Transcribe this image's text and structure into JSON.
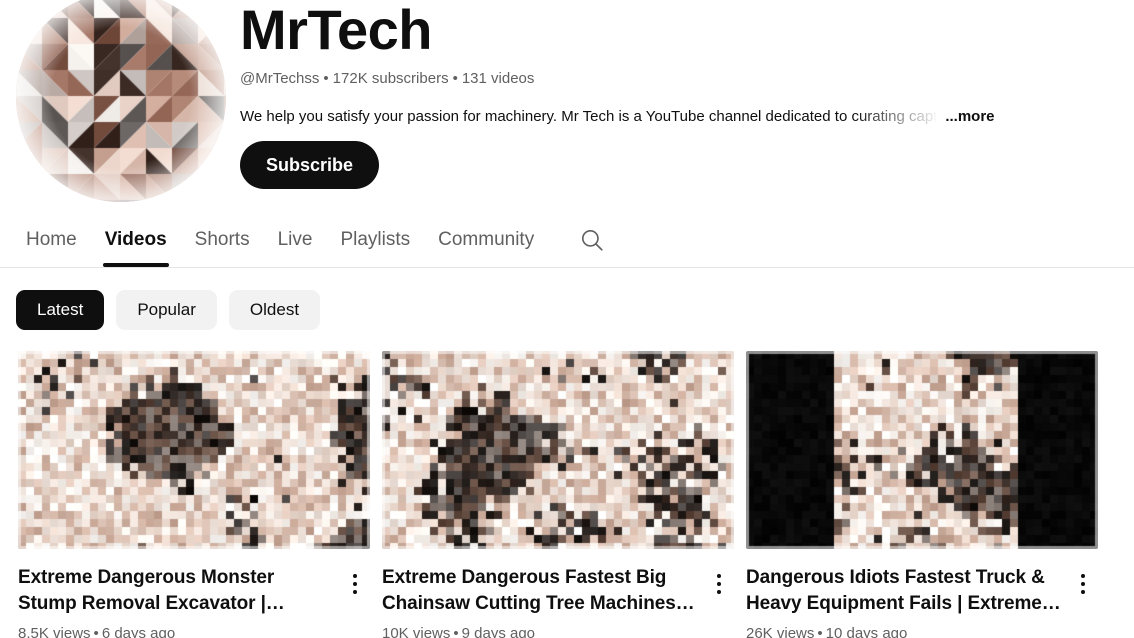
{
  "channel": {
    "name": "MrTech",
    "handle": "@MrTechss",
    "subscribers": "172K subscribers",
    "videos_count": "131 videos",
    "separator": "•",
    "description": "We help you satisfy your passion for machinery. Mr Tech is a YouTube channel dedicated to curating capt",
    "more_label": "...more",
    "subscribe_label": "Subscribe",
    "avatar_alt": "channel-avatar"
  },
  "tabs": [
    {
      "label": "Home",
      "active": false
    },
    {
      "label": "Videos",
      "active": true
    },
    {
      "label": "Shorts",
      "active": false
    },
    {
      "label": "Live",
      "active": false
    },
    {
      "label": "Playlists",
      "active": false
    },
    {
      "label": "Community",
      "active": false
    }
  ],
  "search_icon": "search-icon",
  "chips": [
    {
      "label": "Latest",
      "selected": true
    },
    {
      "label": "Popular",
      "selected": false
    },
    {
      "label": "Oldest",
      "selected": false
    }
  ],
  "videos": [
    {
      "title": "Extreme Dangerous Monster Stump Removal Excavator | Fastest Stump...",
      "views": "8.5K views",
      "age": "6 days ago",
      "separator": "•",
      "thumb_style": "pixelated-light",
      "menu_icon": "more-vertical-icon"
    },
    {
      "title": "Extreme Dangerous Fastest Big Chainsaw Cutting Tree Machines |...",
      "views": "10K views",
      "age": "9 days ago",
      "separator": "•",
      "thumb_style": "pixelated-light",
      "menu_icon": "more-vertical-icon"
    },
    {
      "title": "Dangerous Idiots Fastest Truck & Heavy Equipment Fails | Extreme Truc...",
      "views": "26K views",
      "age": "10 days ago",
      "separator": "•",
      "thumb_style": "pixelated-letterbox",
      "menu_icon": "more-vertical-icon"
    }
  ],
  "colors": {
    "text_primary": "#0f0f0f",
    "text_secondary": "#606060",
    "chip_bg": "#f2f2f2",
    "chip_selected_bg": "#0f0f0f",
    "divider": "#e5e5e5",
    "background": "#ffffff"
  }
}
